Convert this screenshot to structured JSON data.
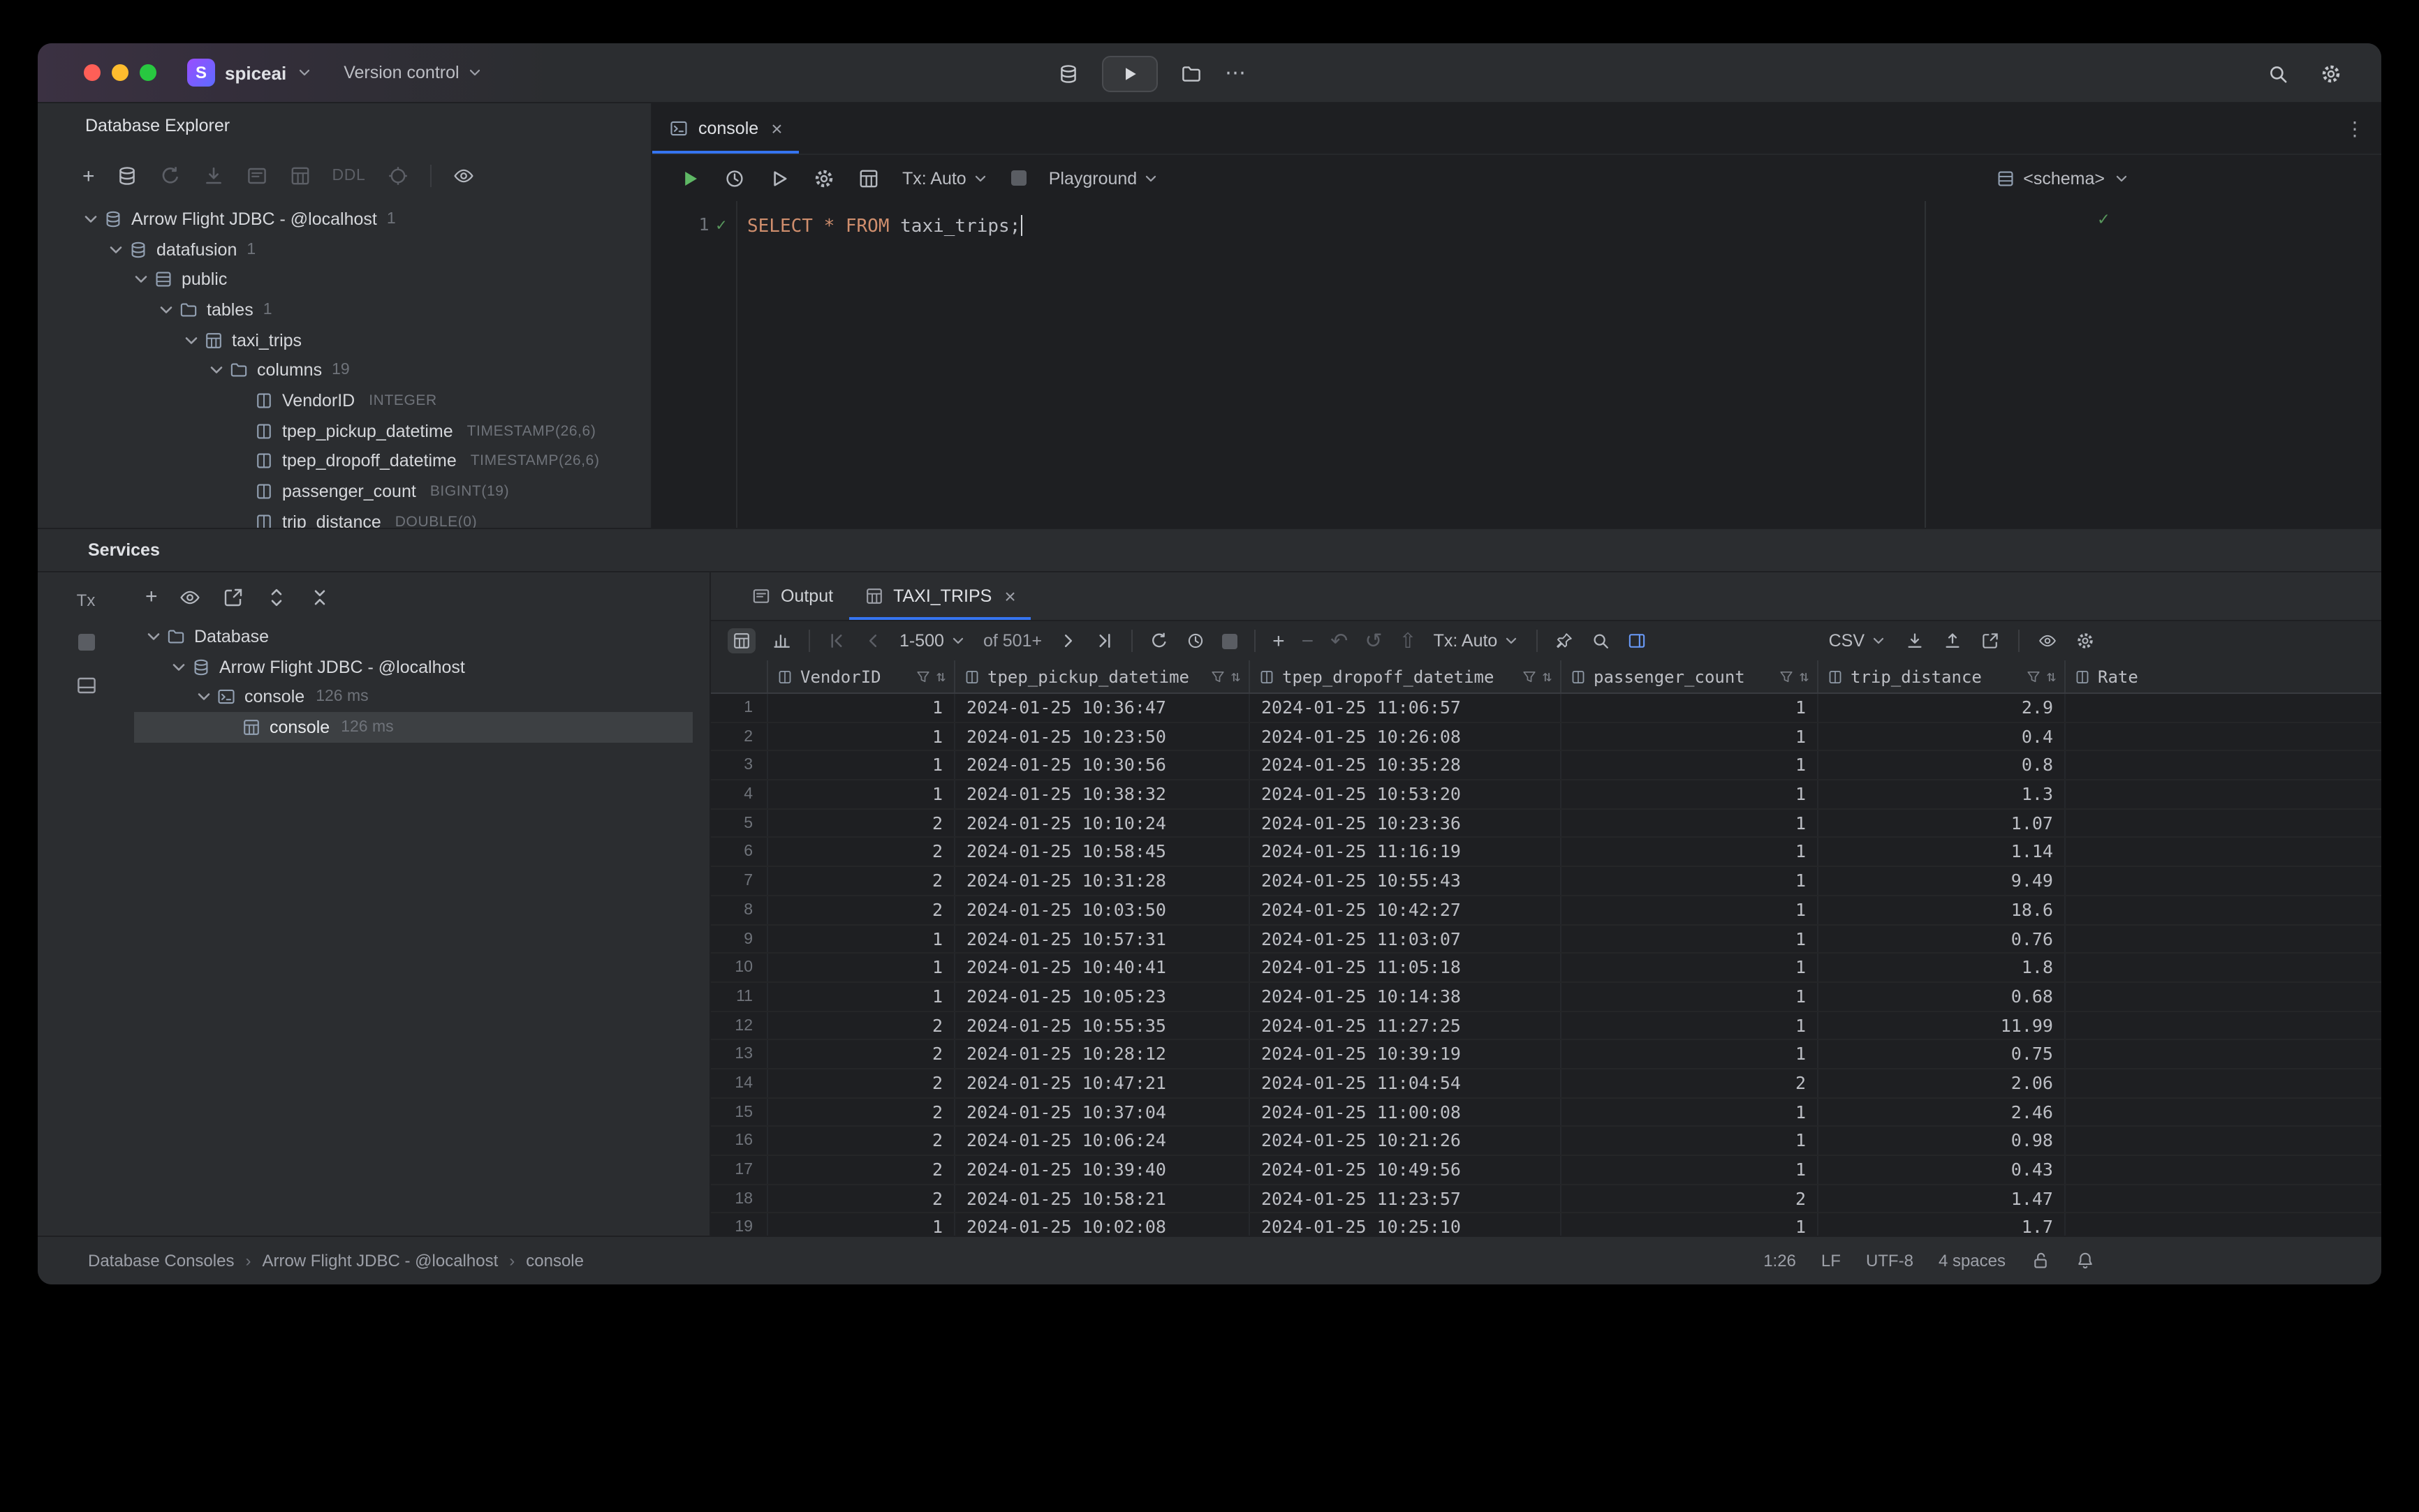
{
  "titlebar": {
    "project_initial": "S",
    "project_name": "spiceai",
    "version_control": "Version control"
  },
  "database_explorer": {
    "title": "Database Explorer",
    "ddl_button": "DDL",
    "tree": [
      {
        "label": "Arrow Flight JDBC - @localhost",
        "badge": "1",
        "icon": "database",
        "level": 0,
        "expanded": true
      },
      {
        "label": "datafusion",
        "badge": "1",
        "icon": "database",
        "level": 1,
        "expanded": true
      },
      {
        "label": "public",
        "icon": "schema",
        "level": 2,
        "expanded": true
      },
      {
        "label": "tables",
        "badge": "1",
        "icon": "folder",
        "level": 3,
        "expanded": true
      },
      {
        "label": "taxi_trips",
        "icon": "table",
        "level": 4,
        "expanded": true
      },
      {
        "label": "columns",
        "badge": "19",
        "icon": "folder",
        "level": 5,
        "expanded": true
      },
      {
        "label": "VendorID",
        "type": "INTEGER",
        "icon": "column",
        "level": 6
      },
      {
        "label": "tpep_pickup_datetime",
        "type": "TIMESTAMP(26,6)",
        "icon": "column",
        "level": 6
      },
      {
        "label": "tpep_dropoff_datetime",
        "type": "TIMESTAMP(26,6)",
        "icon": "column",
        "level": 6
      },
      {
        "label": "passenger_count",
        "type": "BIGINT(19)",
        "icon": "column",
        "level": 6
      },
      {
        "label": "trip_distance",
        "type": "DOUBLE(0)",
        "icon": "column",
        "level": 6
      }
    ]
  },
  "editor": {
    "tab_label": "console",
    "tx_mode": "Tx: Auto",
    "playground": "Playground",
    "schema_selector": "<schema>",
    "line_number": "1",
    "sql": {
      "keywords": "SELECT * FROM",
      "table": " taxi_trips",
      "terminator": ";"
    }
  },
  "services": {
    "title": "Services",
    "strip_label": "Tx",
    "tree": [
      {
        "label": "Database",
        "icon": "folder",
        "level": 0,
        "expanded": true
      },
      {
        "label": "Arrow Flight JDBC - @localhost",
        "icon": "database",
        "level": 1,
        "expanded": true
      },
      {
        "label": "console",
        "time": "126 ms",
        "icon": "console",
        "level": 2,
        "expanded": true
      },
      {
        "label": "console",
        "time": "126 ms",
        "icon": "table",
        "level": 3,
        "selected": true
      }
    ]
  },
  "results": {
    "tab_output": "Output",
    "tab_result": "TAXI_TRIPS",
    "page_range": "1-500",
    "page_of": "of 501+",
    "tx_mode": "Tx: Auto",
    "export_format": "CSV",
    "columns": [
      {
        "name": "VendorID",
        "align": "right"
      },
      {
        "name": "tpep_pickup_datetime",
        "align": "left"
      },
      {
        "name": "tpep_dropoff_datetime",
        "align": "left"
      },
      {
        "name": "passenger_count",
        "align": "right"
      },
      {
        "name": "trip_distance",
        "align": "right"
      },
      {
        "name": "Rate",
        "align": "left"
      }
    ],
    "rows": [
      [
        "1",
        "2024-01-25 10:36:47",
        "2024-01-25 11:06:57",
        "1",
        "2.9",
        ""
      ],
      [
        "1",
        "2024-01-25 10:23:50",
        "2024-01-25 10:26:08",
        "1",
        "0.4",
        ""
      ],
      [
        "1",
        "2024-01-25 10:30:56",
        "2024-01-25 10:35:28",
        "1",
        "0.8",
        ""
      ],
      [
        "1",
        "2024-01-25 10:38:32",
        "2024-01-25 10:53:20",
        "1",
        "1.3",
        ""
      ],
      [
        "2",
        "2024-01-25 10:10:24",
        "2024-01-25 10:23:36",
        "1",
        "1.07",
        ""
      ],
      [
        "2",
        "2024-01-25 10:58:45",
        "2024-01-25 11:16:19",
        "1",
        "1.14",
        ""
      ],
      [
        "2",
        "2024-01-25 10:31:28",
        "2024-01-25 10:55:43",
        "1",
        "9.49",
        ""
      ],
      [
        "2",
        "2024-01-25 10:03:50",
        "2024-01-25 10:42:27",
        "1",
        "18.6",
        ""
      ],
      [
        "1",
        "2024-01-25 10:57:31",
        "2024-01-25 11:03:07",
        "1",
        "0.76",
        ""
      ],
      [
        "1",
        "2024-01-25 10:40:41",
        "2024-01-25 11:05:18",
        "1",
        "1.8",
        ""
      ],
      [
        "1",
        "2024-01-25 10:05:23",
        "2024-01-25 10:14:38",
        "1",
        "0.68",
        ""
      ],
      [
        "2",
        "2024-01-25 10:55:35",
        "2024-01-25 11:27:25",
        "1",
        "11.99",
        ""
      ],
      [
        "2",
        "2024-01-25 10:28:12",
        "2024-01-25 10:39:19",
        "1",
        "0.75",
        ""
      ],
      [
        "2",
        "2024-01-25 10:47:21",
        "2024-01-25 11:04:54",
        "2",
        "2.06",
        ""
      ],
      [
        "2",
        "2024-01-25 10:37:04",
        "2024-01-25 11:00:08",
        "1",
        "2.46",
        ""
      ],
      [
        "2",
        "2024-01-25 10:06:24",
        "2024-01-25 10:21:26",
        "1",
        "0.98",
        ""
      ],
      [
        "2",
        "2024-01-25 10:39:40",
        "2024-01-25 10:49:56",
        "1",
        "0.43",
        ""
      ],
      [
        "2",
        "2024-01-25 10:58:21",
        "2024-01-25 11:23:57",
        "2",
        "1.47",
        ""
      ],
      [
        "1",
        "2024-01-25 10:02:08",
        "2024-01-25 10:25:10",
        "1",
        "1.7",
        ""
      ]
    ]
  },
  "statusbar": {
    "breadcrumbs": [
      "Database Consoles",
      "Arrow Flight JDBC - @localhost",
      "console"
    ],
    "caret_position": "1:26",
    "line_separator": "LF",
    "encoding": "UTF-8",
    "indent": "4 spaces"
  },
  "colors": {
    "accent": "#3574f0",
    "keyword_orange": "#cf8e6d",
    "success_green": "#57965c",
    "selection_gray": "#3d4043"
  },
  "icons": {
    "search": "magnifier",
    "settings": "gear",
    "notifications": "bell",
    "lock": "open-padlock",
    "run": "play-triangle",
    "stop": "gray-square",
    "history": "clock",
    "refresh": "circular-arrow",
    "filter": "funnel",
    "sort": "up-down-arrows",
    "pin": "pin",
    "export": "square-with-arrow",
    "chevron": "angle-down",
    "close": "x",
    "more": "ellipsis",
    "add": "+",
    "remove": "-",
    "undo": "curved-arrow"
  }
}
